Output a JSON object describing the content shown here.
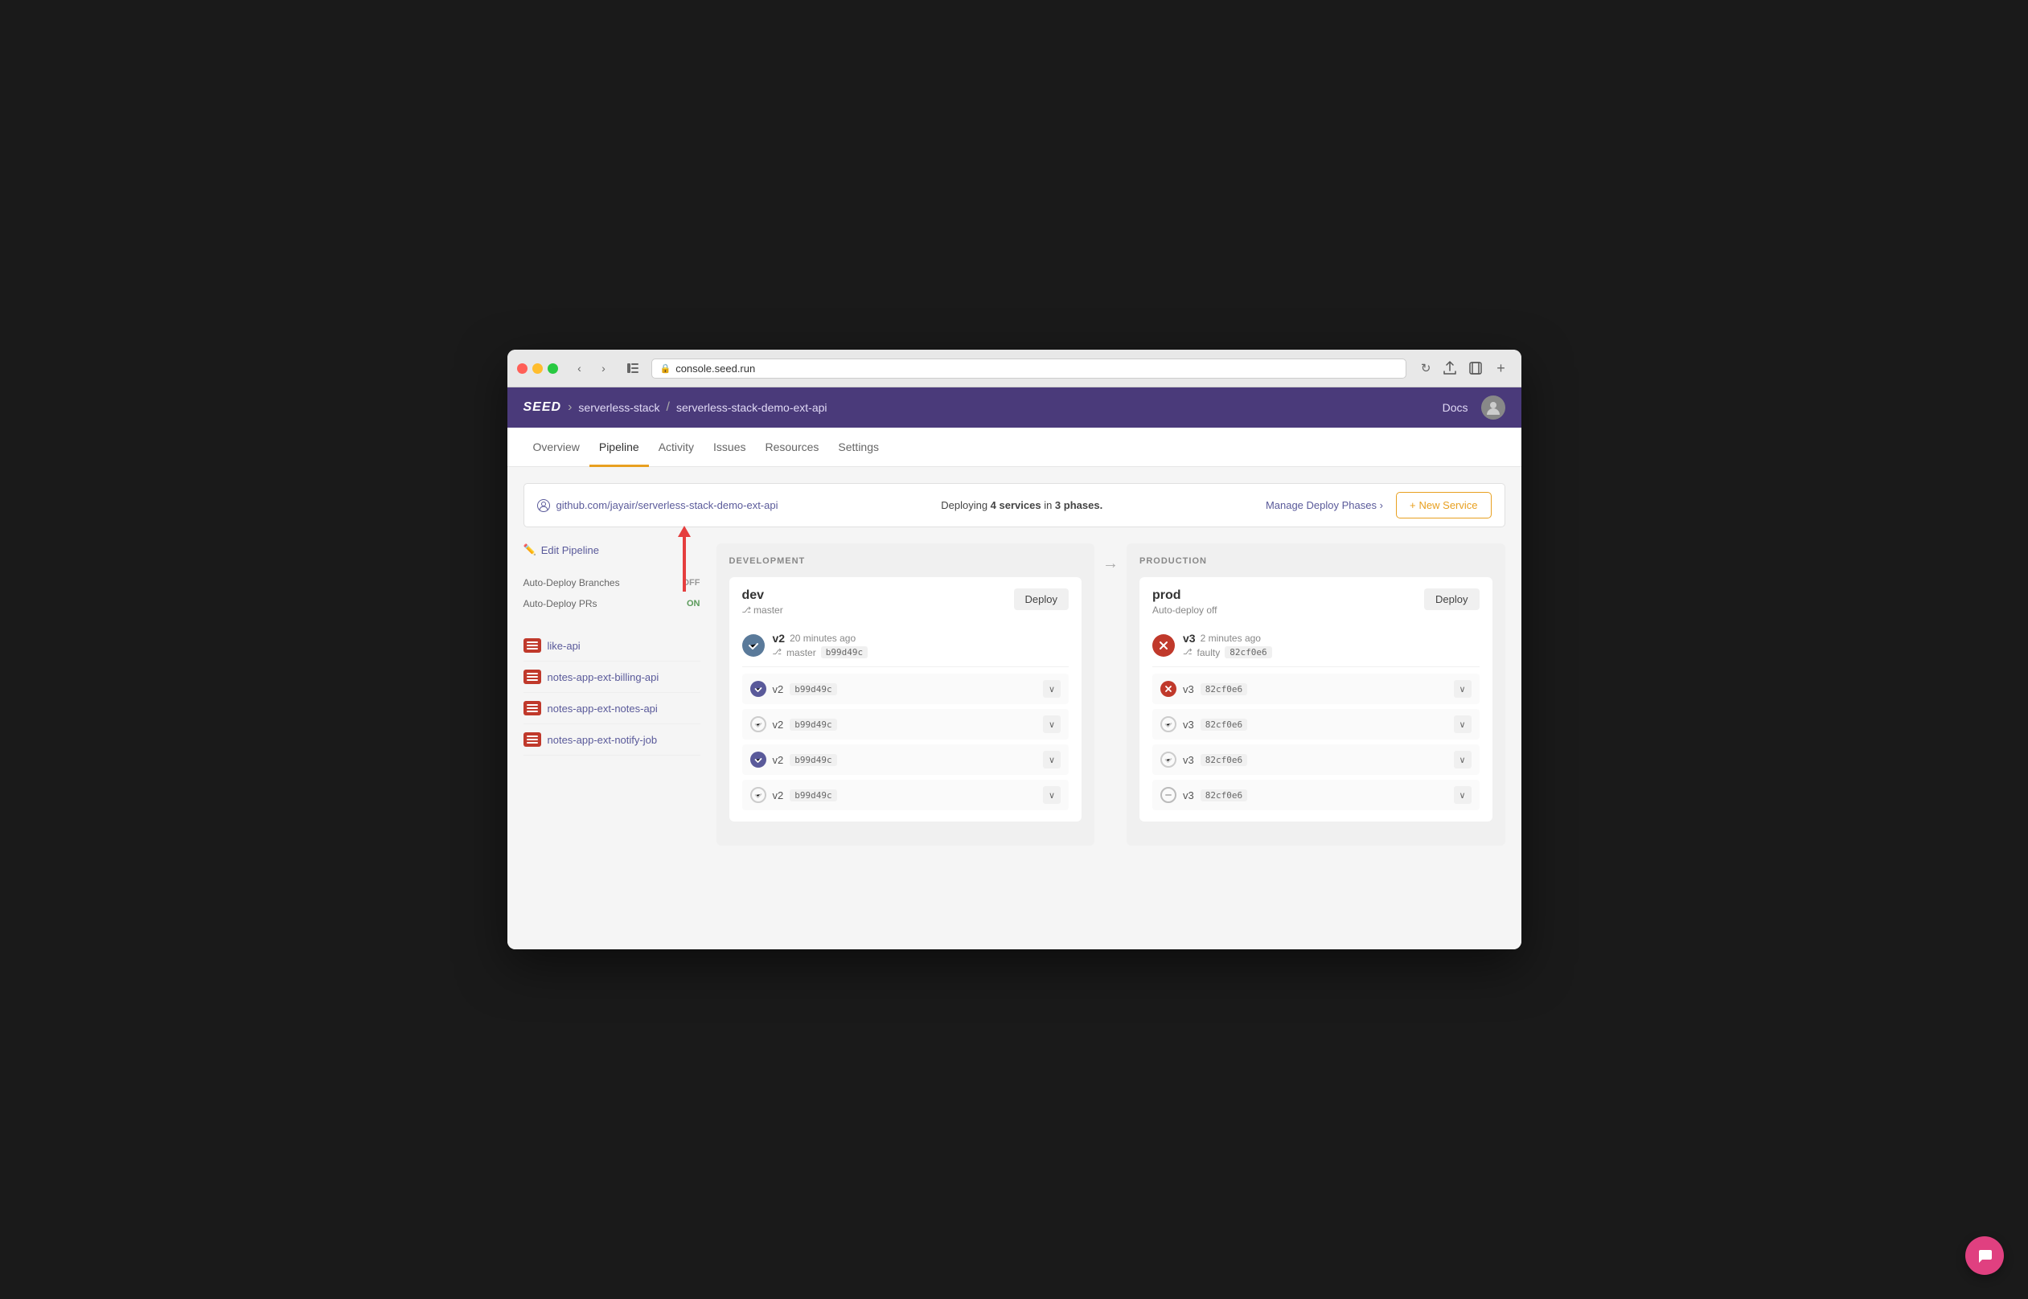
{
  "browser": {
    "url": "console.seed.run",
    "back_btn": "‹",
    "forward_btn": "›"
  },
  "header": {
    "logo": "SEED",
    "breadcrumb": [
      {
        "label": "serverless-stack"
      },
      {
        "label": "serverless-stack-demo-ext-api"
      }
    ],
    "docs_label": "Docs"
  },
  "nav_tabs": [
    {
      "label": "Overview",
      "active": false
    },
    {
      "label": "Pipeline",
      "active": true
    },
    {
      "label": "Activity",
      "active": false
    },
    {
      "label": "Issues",
      "active": false
    },
    {
      "label": "Resources",
      "active": false
    },
    {
      "label": "Settings",
      "active": false
    }
  ],
  "repo_bar": {
    "github_icon": "⎇",
    "repo_url": "github.com/jayair/serverless-stack-demo-ext-api",
    "deploy_info": "Deploying",
    "service_count": "4 services",
    "phases_text": "in",
    "phase_count": "3 phases.",
    "manage_phases": "Manage Deploy Phases",
    "manage_arrow": ">",
    "new_service_plus": "+",
    "new_service_label": "New Service"
  },
  "sidebar": {
    "edit_pipeline_label": "Edit Pipeline",
    "settings": [
      {
        "label": "Auto-Deploy Branches",
        "value": "OFF",
        "type": "off"
      },
      {
        "label": "Auto-Deploy PRs",
        "value": "ON",
        "type": "on"
      }
    ],
    "services": [
      {
        "name": "like-api"
      },
      {
        "name": "notes-app-ext-billing-api"
      },
      {
        "name": "notes-app-ext-notes-api"
      },
      {
        "name": "notes-app-ext-notify-job"
      }
    ]
  },
  "stages": {
    "development": {
      "label": "DEVELOPMENT",
      "environments": [
        {
          "name": "dev",
          "branch": "master",
          "deploy_btn": "Deploy",
          "summary": {
            "version": "v2",
            "time": "20 minutes ago",
            "branch": "master",
            "commit": "b99d49c",
            "icon_type": "success"
          },
          "services": [
            {
              "version": "v2",
              "commit": "b99d49c",
              "icon_type": "check_purple"
            },
            {
              "version": "v2",
              "commit": "b99d49c",
              "icon_type": "check_gray"
            },
            {
              "version": "v2",
              "commit": "b99d49c",
              "icon_type": "check_purple"
            },
            {
              "version": "v2",
              "commit": "b99d49c",
              "icon_type": "check_gray"
            }
          ]
        }
      ]
    },
    "production": {
      "label": "PRODUCTION",
      "environments": [
        {
          "name": "prod",
          "branch": "Auto-deploy off",
          "deploy_btn": "Deploy",
          "summary": {
            "version": "v3",
            "time": "2 minutes ago",
            "branch": "faulty",
            "commit": "82cf0e6",
            "icon_type": "error"
          },
          "services": [
            {
              "version": "v3",
              "commit": "82cf0e6",
              "icon_type": "error_orange"
            },
            {
              "version": "v3",
              "commit": "82cf0e6",
              "icon_type": "check_gray"
            },
            {
              "version": "v3",
              "commit": "82cf0e6",
              "icon_type": "check_gray"
            },
            {
              "version": "v3",
              "commit": "82cf0e6",
              "icon_type": "minus_gray"
            }
          ]
        }
      ]
    }
  }
}
